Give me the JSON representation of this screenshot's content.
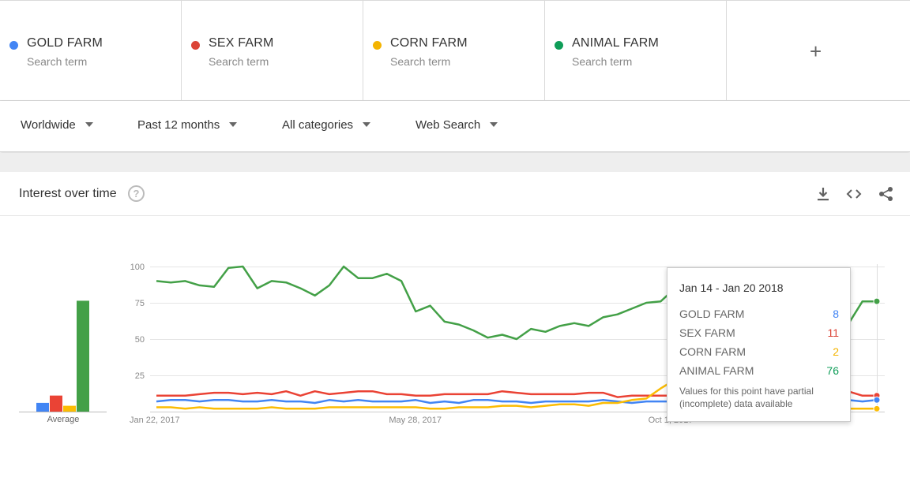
{
  "terms": [
    {
      "name": "GOLD FARM",
      "sub": "Search term",
      "color": "#4285f4"
    },
    {
      "name": "SEX FARM",
      "sub": "Search term",
      "color": "#db4437"
    },
    {
      "name": "CORN FARM",
      "sub": "Search term",
      "color": "#f4b400"
    },
    {
      "name": "ANIMAL FARM",
      "sub": "Search term",
      "color": "#0f9d58"
    }
  ],
  "add_label": "+",
  "filters": {
    "region": "Worldwide",
    "time": "Past 12 months",
    "category": "All categories",
    "search_type": "Web Search"
  },
  "card": {
    "title": "Interest over time",
    "help": "?"
  },
  "icons": [
    "download-icon",
    "embed-icon",
    "share-icon",
    "help-icon"
  ],
  "average_label": "Average",
  "tooltip": {
    "date": "Jan 14 - Jan 20 2018",
    "rows": [
      {
        "name": "GOLD FARM",
        "value": "8",
        "color": "#4285f4"
      },
      {
        "name": "SEX FARM",
        "value": "11",
        "color": "#db4437"
      },
      {
        "name": "CORN FARM",
        "value": "2",
        "color": "#f4b400"
      },
      {
        "name": "ANIMAL FARM",
        "value": "76",
        "color": "#0f9d58"
      }
    ],
    "note": "Values for this point have partial (incomplete) data available"
  },
  "chart_data": [
    {
      "type": "bar",
      "title": "",
      "categories": [
        "Average"
      ],
      "series": [
        {
          "name": "GOLD FARM",
          "values": [
            6
          ],
          "color": "#4285f4"
        },
        {
          "name": "SEX FARM",
          "values": [
            11
          ],
          "color": "#ea4335"
        },
        {
          "name": "CORN FARM",
          "values": [
            4
          ],
          "color": "#fbbc04"
        },
        {
          "name": "ANIMAL FARM",
          "values": [
            76
          ],
          "color": "#43a047"
        }
      ],
      "ylim": [
        0,
        100
      ]
    },
    {
      "type": "line",
      "title": "",
      "yticks": [
        25,
        50,
        75,
        100
      ],
      "ylim": [
        0,
        100
      ],
      "x_tick_labels": [
        "Jan 22, 2017",
        "May 28, 2017",
        "Oct 1, 2017"
      ],
      "x_tick_indices": [
        0,
        18,
        36
      ],
      "series": [
        {
          "name": "ANIMAL FARM",
          "color": "#43a047",
          "values": [
            90,
            89,
            90,
            87,
            86,
            99,
            100,
            85,
            90,
            89,
            85,
            80,
            87,
            100,
            92,
            92,
            95,
            90,
            69,
            73,
            62,
            60,
            56,
            51,
            53,
            50,
            57,
            55,
            59,
            61,
            59,
            65,
            67,
            71,
            75,
            76,
            85,
            78,
            82,
            80,
            84,
            85,
            87,
            63,
            88,
            89,
            88,
            40,
            60,
            76,
            76
          ]
        },
        {
          "name": "SEX FARM",
          "color": "#ea4335",
          "values": [
            11,
            11,
            11,
            12,
            13,
            13,
            12,
            13,
            12,
            14,
            11,
            14,
            12,
            13,
            14,
            14,
            12,
            12,
            11,
            11,
            12,
            12,
            12,
            12,
            14,
            13,
            12,
            12,
            12,
            12,
            13,
            13,
            10,
            11,
            11,
            11,
            11,
            11,
            11,
            11,
            11,
            11,
            11,
            11,
            12,
            11,
            11,
            11,
            14,
            11,
            11
          ]
        },
        {
          "name": "GOLD FARM",
          "color": "#4285f4",
          "values": [
            7,
            8,
            8,
            7,
            8,
            8,
            7,
            7,
            8,
            7,
            7,
            6,
            8,
            7,
            8,
            7,
            7,
            7,
            8,
            6,
            7,
            6,
            8,
            8,
            7,
            7,
            6,
            7,
            7,
            7,
            7,
            8,
            7,
            6,
            7,
            7,
            7,
            7,
            7,
            7,
            7,
            7,
            7,
            7,
            7,
            7,
            7,
            7,
            8,
            7,
            8
          ]
        },
        {
          "name": "CORN FARM",
          "color": "#fbbc04",
          "values": [
            3,
            3,
            2,
            3,
            2,
            2,
            2,
            2,
            3,
            2,
            2,
            2,
            3,
            3,
            3,
            3,
            3,
            3,
            3,
            2,
            2,
            3,
            3,
            3,
            4,
            4,
            3,
            4,
            5,
            5,
            4,
            6,
            6,
            8,
            9,
            16,
            22,
            25,
            24,
            20,
            18,
            14,
            10,
            6,
            4,
            3,
            3,
            2,
            2,
            2,
            2
          ]
        }
      ]
    }
  ]
}
